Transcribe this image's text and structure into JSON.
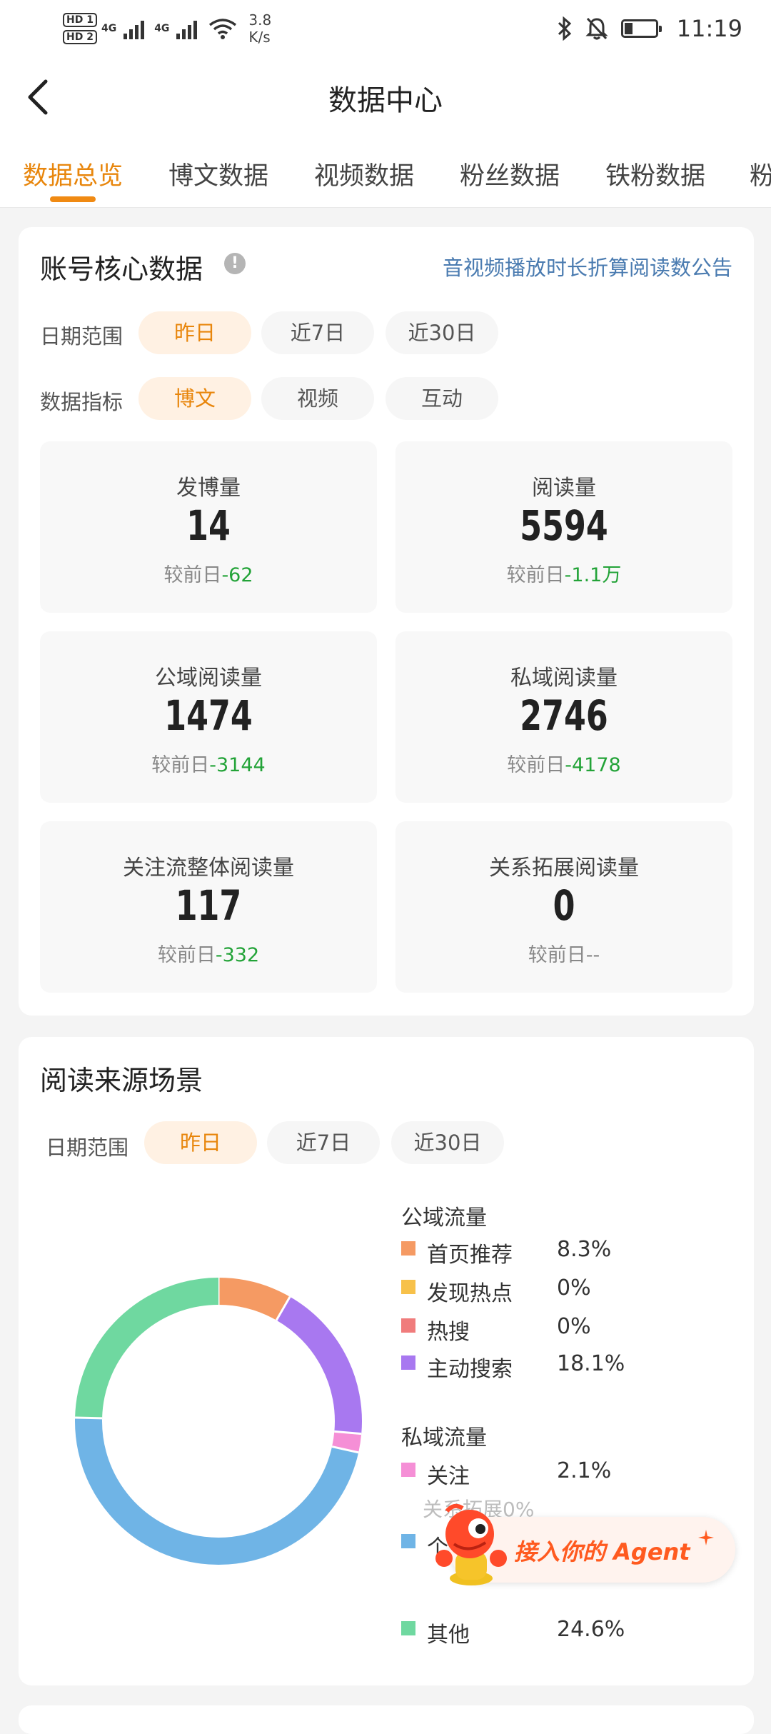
{
  "status_bar": {
    "hd1": "HD 1",
    "hd2": "HD 2",
    "sig1": "4G",
    "sig2": "4G",
    "speed": "3.8",
    "speed_unit": "K/s",
    "time": "11:19"
  },
  "header": {
    "title": "数据中心"
  },
  "tabs": [
    {
      "label": "数据总览",
      "active": true
    },
    {
      "label": "博文数据"
    },
    {
      "label": "视频数据"
    },
    {
      "label": "粉丝数据"
    },
    {
      "label": "铁粉数据"
    },
    {
      "label": "粉"
    }
  ],
  "core": {
    "title": "账号核心数据",
    "info_icon": "!",
    "notice_link": "音视频播放时长折算阅读数公告",
    "date_label": "日期范围",
    "date_options": [
      "昨日",
      "近7日",
      "近30日"
    ],
    "metric_label": "数据指标",
    "metric_options": [
      "博文",
      "视频",
      "互动"
    ],
    "compare_prefix": "较前日",
    "metrics": [
      {
        "label": "发博量",
        "value": "14",
        "change": "-62"
      },
      {
        "label": "阅读量",
        "value": "5594",
        "change": "-1.1万"
      },
      {
        "label": "公域阅读量",
        "value": "1474",
        "change": "-3144"
      },
      {
        "label": "私域阅读量",
        "value": "2746",
        "change": "-4178"
      },
      {
        "label": "关注流整体阅读量",
        "value": "117",
        "change": "-332"
      },
      {
        "label": "关系拓展阅读量",
        "value": "0",
        "change": "--"
      }
    ]
  },
  "source": {
    "title": "阅读来源场景",
    "date_label": "日期范围",
    "date_options": [
      "昨日",
      "近7日",
      "近30日"
    ],
    "public_title": "公域流量",
    "public_items": [
      {
        "name": "首页推荐",
        "value": "8.3%",
        "color": "#f59a63"
      },
      {
        "name": "发现热点",
        "value": "0%",
        "color": "#f7c14a"
      },
      {
        "name": "热搜",
        "value": "0%",
        "color": "#f07c7c"
      },
      {
        "name": "主动搜索",
        "value": "18.1%",
        "color": "#a878f0"
      }
    ],
    "private_title": "私域流量",
    "private_items": [
      {
        "name": "关注",
        "value": "2.1%",
        "color": "#f58fd6"
      },
      {
        "name": "个",
        "value": "",
        "color": "#6fb4e6"
      }
    ],
    "faded_note": "关系拓展0%",
    "other_item": {
      "name": "其他",
      "value": "24.6%",
      "color": "#6fd8a0"
    }
  },
  "chart_data": {
    "type": "pie",
    "title": "",
    "categories": [
      "首页推荐",
      "发现热点",
      "热搜",
      "主动搜索",
      "关注",
      "关系拓展",
      "个",
      "其他"
    ],
    "values": [
      8.3,
      0,
      0,
      18.1,
      2.1,
      0,
      46.9,
      24.6
    ],
    "colors": [
      "#f59a63",
      "#f7c14a",
      "#f07c7c",
      "#a878f0",
      "#f58fd6",
      "#e0e0e0",
      "#6fb4e6",
      "#6fd8a0"
    ]
  },
  "agent": {
    "label": "接入你的 Agent"
  }
}
